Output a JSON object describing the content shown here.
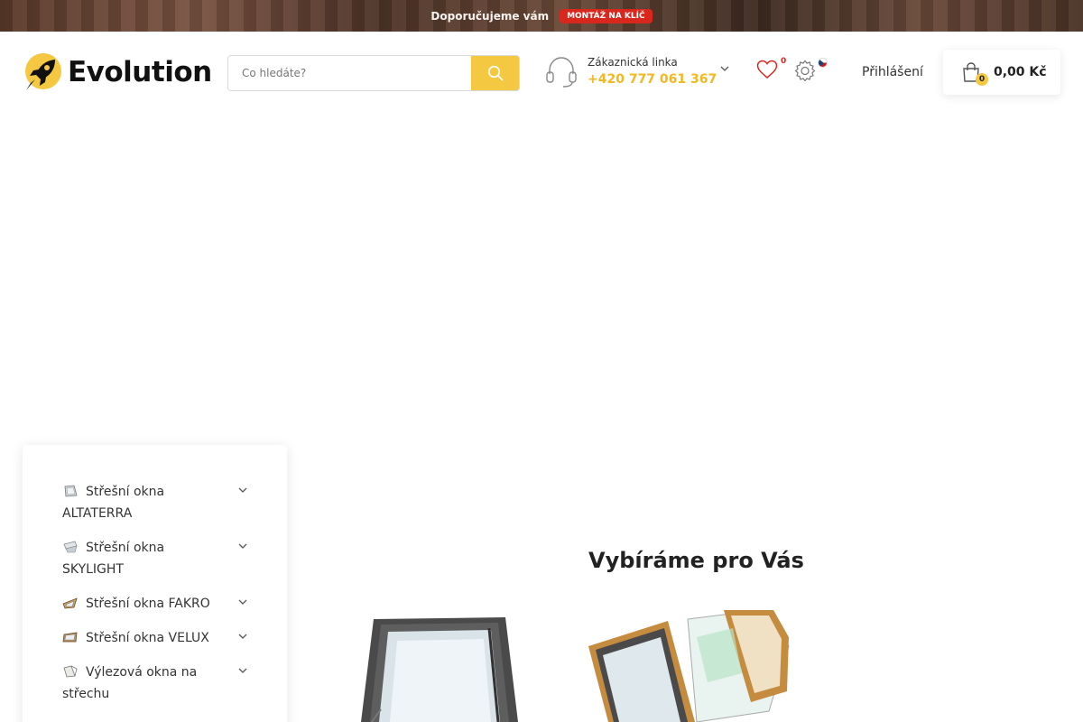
{
  "promo": {
    "text": "Doporučujeme vám",
    "badge": "MONTÁŽ NA KLÍČ"
  },
  "logo": {
    "text": "Evolution",
    "icon": "rocket-icon"
  },
  "search": {
    "placeholder": "Co hledáte?",
    "button_icon": "search-icon"
  },
  "support": {
    "label": "Zákaznická linka",
    "phone": "+420 777 061 367",
    "icon": "headset-icon"
  },
  "wishlist": {
    "count": "0",
    "icon": "heart-icon"
  },
  "settings": {
    "icon": "gear-icon",
    "language_icon": "czech-flag-icon"
  },
  "login": {
    "label": "Přihlášení"
  },
  "cart": {
    "count": "0",
    "total": "0,00 Kč",
    "icon": "shopping-bag-icon"
  },
  "categories": [
    {
      "label": "Střešní okna ALTATERRA",
      "icon": "roof-window-icon"
    },
    {
      "label": "Střešní okna SKYLIGHT",
      "icon": "roof-window-icon"
    },
    {
      "label": "Střešní okna FAKRO",
      "icon": "roof-window-icon"
    },
    {
      "label": "Střešní okna VELUX",
      "icon": "roof-window-icon"
    },
    {
      "label": "Výlezová okna na střechu",
      "icon": "roof-window-icon"
    }
  ],
  "featured": {
    "title": "Vybíráme pro Vás"
  },
  "colors": {
    "accent": "#f5c842",
    "phone": "#f2b823",
    "badge": "#d8271d"
  }
}
